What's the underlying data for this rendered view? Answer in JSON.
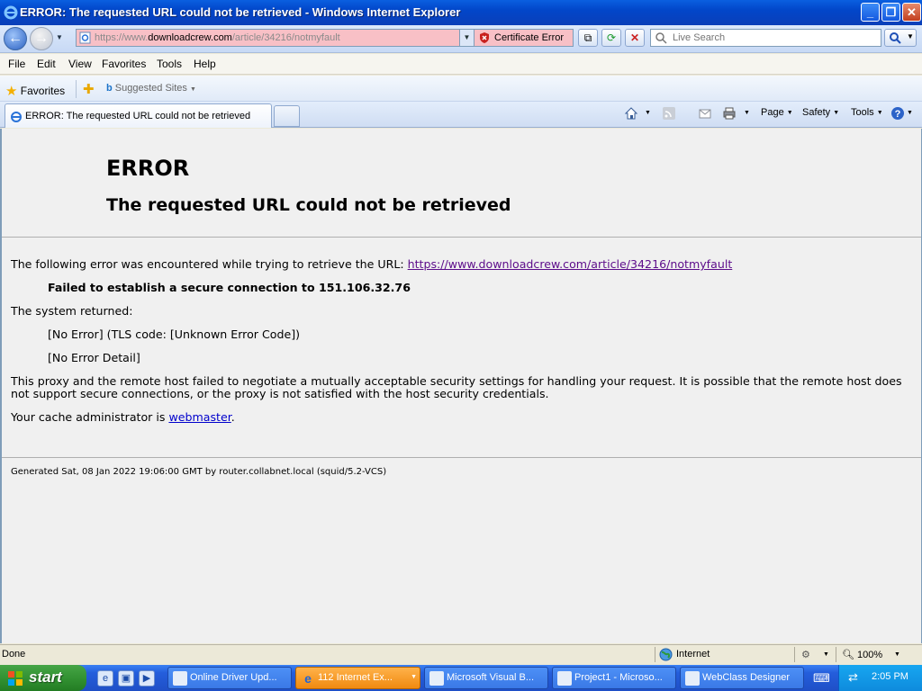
{
  "window": {
    "title": "ERROR: The requested URL could not be retrieved - Windows Internet Explorer"
  },
  "address": {
    "url_prefix": "https://www.",
    "url_domain": "downloadcrew.com",
    "url_suffix": "/article/34216/notmyfault",
    "cert_error": "Certificate Error"
  },
  "search": {
    "placeholder": "Live Search"
  },
  "menu": {
    "items": [
      "File",
      "Edit",
      "View",
      "Favorites",
      "Tools",
      "Help"
    ]
  },
  "favorites": {
    "label": "Favorites",
    "suggested": "Suggested Sites"
  },
  "tab": {
    "title": "ERROR: The requested URL could not be retrieved"
  },
  "commandbar": {
    "page": "Page",
    "safety": "Safety",
    "tools": "Tools"
  },
  "page": {
    "heading": "ERROR",
    "subheading": "The requested URL could not be retrieved",
    "intro": "The following error was encountered while trying to retrieve the URL:",
    "url_link": "https://www.downloadcrew.com/article/34216/notmyfault",
    "failed": "Failed to establish a secure connection to 151.106.32.76",
    "system_returned": "The system returned:",
    "tls_error": "[No Error] (TLS code: [Unknown Error Code])",
    "error_detail": "[No Error Detail]",
    "explain_line1": "This proxy and the remote host failed to negotiate a mutually acceptable security settings for handling your request. It is possible that the remote host does",
    "explain_line2": "not support secure connections, or the proxy is not satisfied with the host security credentials.",
    "cache_admin_prefix": "Your cache administrator is",
    "cache_admin_link": "webmaster",
    "cache_admin_suffix": ".",
    "generated": "Generated Sat, 08 Jan 2022 19:06:00 GMT by router.collabnet.local (squid/5.2-VCS)"
  },
  "status": {
    "text": "Done",
    "zone": "Internet",
    "zoom": "100%"
  },
  "taskbar": {
    "start": "start",
    "tasks": [
      {
        "label": "Online Driver Upd..."
      },
      {
        "label": "112 Internet Ex..."
      },
      {
        "label": "Microsoft Visual B..."
      },
      {
        "label": "Project1 - Microso..."
      },
      {
        "label": "WebClass Designer"
      }
    ],
    "clock": "2:05 PM"
  }
}
